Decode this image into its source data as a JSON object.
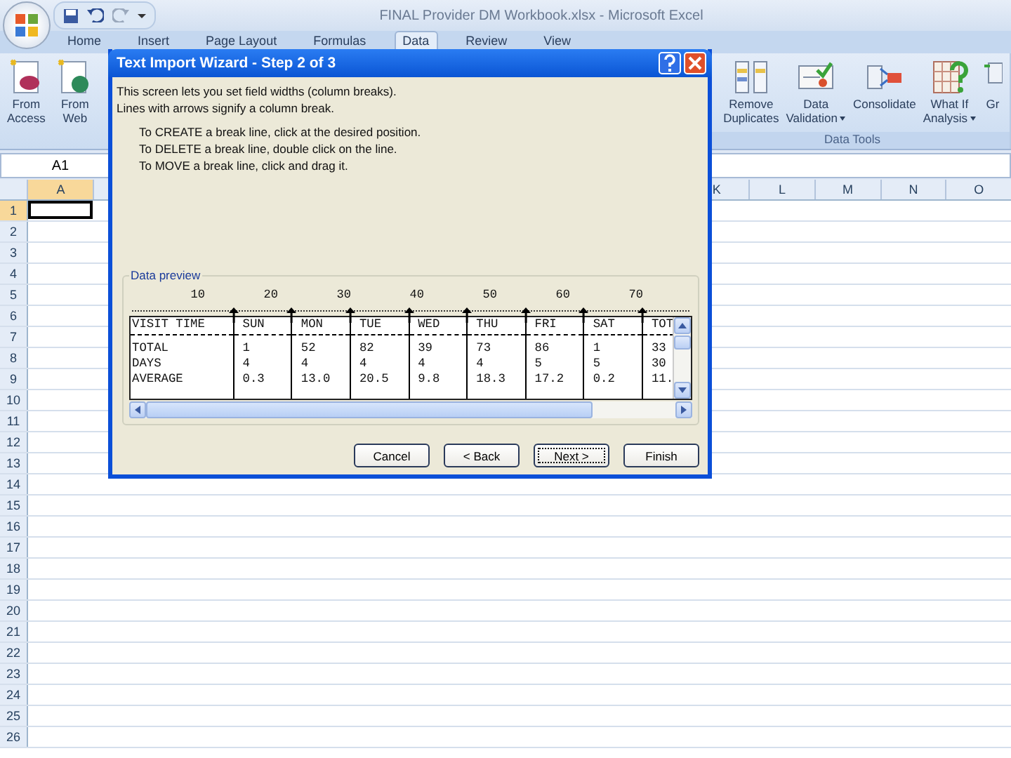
{
  "window": {
    "title": "FINAL Provider DM Workbook.xlsx - Microsoft Excel"
  },
  "ribbon_tabs": [
    {
      "label": "Home",
      "selected": false
    },
    {
      "label": "Insert",
      "selected": false
    },
    {
      "label": "Page Layout",
      "selected": false
    },
    {
      "label": "Formulas",
      "selected": false
    },
    {
      "label": "Data",
      "selected": true
    },
    {
      "label": "Review",
      "selected": false
    },
    {
      "label": "View",
      "selected": false
    }
  ],
  "ribbon_left": [
    {
      "lines": [
        "From",
        "Access"
      ],
      "kind": "access"
    },
    {
      "lines": [
        "From",
        "Web"
      ],
      "kind": "web"
    }
  ],
  "ribbon_right": {
    "group_label": "Data Tools",
    "items": [
      {
        "lines": [
          "Remove",
          "Duplicates"
        ],
        "kind": "remove",
        "dropdown": false
      },
      {
        "lines": [
          "Data",
          "Validation"
        ],
        "kind": "validation",
        "dropdown": true
      },
      {
        "lines": [
          "Consolidate"
        ],
        "kind": "consolidate",
        "dropdown": false
      },
      {
        "lines": [
          "What If",
          "Analysis"
        ],
        "kind": "whatif",
        "dropdown": true
      },
      {
        "lines": [
          "Gr"
        ],
        "kind": "group",
        "dropdown": false
      }
    ]
  },
  "name_box": "A1",
  "column_headers": [
    {
      "label": "A",
      "selected": true
    },
    {
      "label": "K",
      "selected": false
    },
    {
      "label": "L",
      "selected": false
    },
    {
      "label": "M",
      "selected": false
    },
    {
      "label": "N",
      "selected": false
    },
    {
      "label": "O",
      "selected": false
    }
  ],
  "row_headers": [
    {
      "label": "1",
      "selected": true
    },
    {
      "label": "2",
      "selected": false
    },
    {
      "label": "3",
      "selected": false
    },
    {
      "label": "4",
      "selected": false
    },
    {
      "label": "5",
      "selected": false
    },
    {
      "label": "6",
      "selected": false
    },
    {
      "label": "7",
      "selected": false
    },
    {
      "label": "8",
      "selected": false
    },
    {
      "label": "9",
      "selected": false
    },
    {
      "label": "10",
      "selected": false
    },
    {
      "label": "11",
      "selected": false
    },
    {
      "label": "12",
      "selected": false
    },
    {
      "label": "13",
      "selected": false
    },
    {
      "label": "14",
      "selected": false
    },
    {
      "label": "15",
      "selected": false
    },
    {
      "label": "16",
      "selected": false
    },
    {
      "label": "17",
      "selected": false
    },
    {
      "label": "18",
      "selected": false
    },
    {
      "label": "19",
      "selected": false
    },
    {
      "label": "20",
      "selected": false
    },
    {
      "label": "21",
      "selected": false
    },
    {
      "label": "22",
      "selected": false
    },
    {
      "label": "23",
      "selected": false
    },
    {
      "label": "24",
      "selected": false
    },
    {
      "label": "25",
      "selected": false
    },
    {
      "label": "26",
      "selected": false
    }
  ],
  "dialog": {
    "title": "Text Import Wizard - Step 2 of 3",
    "intro": [
      "This screen lets you set field widths (column breaks).",
      "Lines with arrows signify a column break."
    ],
    "instructions": [
      "To CREATE a break line, click at the desired position.",
      "To DELETE a break line, double click on the line.",
      "To MOVE a break line, click and drag it."
    ],
    "preview": {
      "label": "Data preview",
      "ruler": [
        "10",
        "20",
        "30",
        "40",
        "50",
        "60",
        "70"
      ],
      "header": [
        "VISIT TIME",
        "SUN",
        "MON",
        "TUE",
        "WED",
        "THU",
        "FRI",
        "SAT",
        "TOT"
      ],
      "rows": [
        [
          "TOTAL",
          "1",
          "52",
          "82",
          "39",
          "73",
          "86",
          "1",
          "33"
        ],
        [
          "DAYS",
          "4",
          "4",
          "4",
          "4",
          "4",
          "5",
          "5",
          "30"
        ],
        [
          "AVERAGE",
          "0.3",
          "13.0",
          "20.5",
          "9.8",
          "18.3",
          "17.2",
          "0.2",
          "11."
        ]
      ]
    },
    "buttons": [
      {
        "label": "Cancel",
        "focused": false
      },
      {
        "label": "< Back",
        "focused": false
      },
      {
        "label": "Next >",
        "focused": true
      },
      {
        "label": "Finish",
        "focused": false
      }
    ]
  }
}
